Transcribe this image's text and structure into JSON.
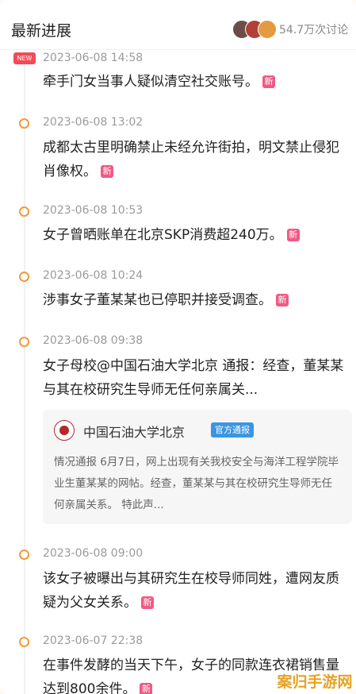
{
  "header": {
    "title": "最新进展",
    "discussion_count": "54.7万次讨论"
  },
  "new_tag": "NEW",
  "new_mark": "新",
  "items": [
    {
      "time": "2023-06-08 14:58",
      "text": "牵手门女当事人疑似清空社交账号。"
    },
    {
      "time": "2023-06-08 13:02",
      "text": "成都太古里明确禁止未经允许街拍，明文禁止侵犯肖像权。"
    },
    {
      "time": "2023-06-08 10:53",
      "text": "女子曾晒账单在北京SKP消费超240万。"
    },
    {
      "time": "2023-06-08 10:24",
      "text": "涉事女子董某某也已停职并接受调查。"
    },
    {
      "time": "2023-06-08 09:38",
      "text": "女子母校@中国石油大学北京 通报：经查，董某某与其在校研究生导师无任何亲属关..."
    },
    {
      "time": "2023-06-08 09:00",
      "text": "该女子被曝出与其研究生在校导师同姓，遭网友质疑为父女关系。"
    },
    {
      "time": "2023-06-07 22:38",
      "text": "在事件发酵的当天下午，女子的同款连衣裙销售量达到800余件。"
    }
  ],
  "quote": {
    "name": "中国石油大学北京",
    "tag": "官方通报",
    "body": "情况通报 6月7日，网上出现有关我校安全与海洋工程学院毕业生董某某的网帖。经查，董某某与其在校研究生导师无任何亲属关系。 特此声..."
  },
  "watermark": "案归手游网",
  "colors": {
    "accent_orange": "#f49a3a",
    "new_red": "#f24b55",
    "xin_pink": "#ef5a85",
    "official_blue": "#3b95e3"
  }
}
